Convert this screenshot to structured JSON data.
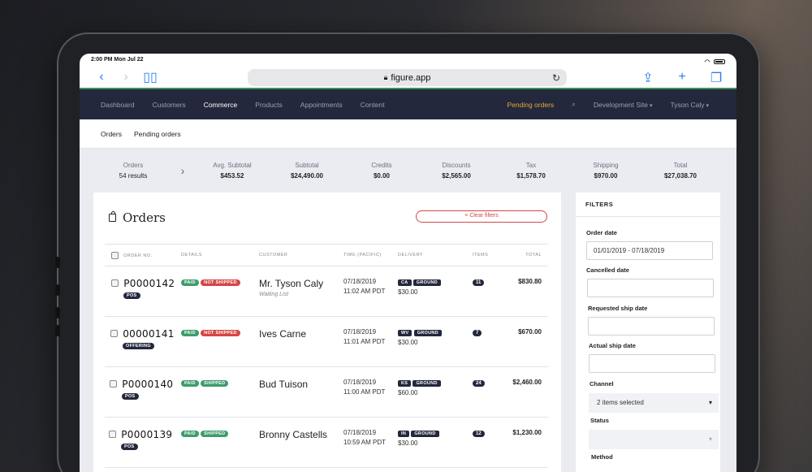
{
  "status_bar": {
    "time": "2:00 PM Mon Jul 22"
  },
  "browser": {
    "url": "figure.app",
    "lock_icon": "lock-icon"
  },
  "top_nav": {
    "items": [
      "Dashboard",
      "Customers",
      "Commerce",
      "Products",
      "Appointments",
      "Content"
    ],
    "active": "Commerce",
    "pending_orders": "Pending orders",
    "site": "Development Site",
    "user": "Tyson Caly"
  },
  "sub_nav": {
    "items": [
      "Orders",
      "Pending orders"
    ]
  },
  "summary": {
    "orders_label": "Orders",
    "orders_value": "54 results",
    "stats": [
      {
        "label": "Avg. Subtotal",
        "value": "$453.52"
      },
      {
        "label": "Subtotal",
        "value": "$24,490.00"
      },
      {
        "label": "Credits",
        "value": "$0.00"
      },
      {
        "label": "Discounts",
        "value": "$2,565.00"
      },
      {
        "label": "Tax",
        "value": "$1,578.70"
      },
      {
        "label": "Shipping",
        "value": "$970.00"
      },
      {
        "label": "Total",
        "value": "$27,038.70"
      }
    ]
  },
  "orders": {
    "title": "Orders",
    "clear_filters": "× Clear filters",
    "columns": [
      "ORDER NO.",
      "DETAILS",
      "CUSTOMER",
      "TIME (PACIFIC)",
      "DELIVERY",
      "ITEMS",
      "TOTAL"
    ],
    "rows": [
      {
        "order_no": "P0000142",
        "source": "POS",
        "paid": "PAID",
        "ship": "NOT SHIPPED",
        "customer": "Mr. Tyson Caly",
        "note": "Waiting List",
        "date": "07/18/2019",
        "time": "11:02 AM PDT",
        "state": "CA",
        "method": "GROUND",
        "delivery_cost": "$30.00",
        "items": "11",
        "total": "$830.80"
      },
      {
        "order_no": "00000141",
        "source": "OFFERING",
        "paid": "PAID",
        "ship": "NOT SHIPPED",
        "customer": "Ives Carne",
        "note": "",
        "date": "07/18/2019",
        "time": "11:01 AM PDT",
        "state": "WV",
        "method": "GROUND",
        "delivery_cost": "$30.00",
        "items": "7",
        "total": "$670.00"
      },
      {
        "order_no": "P0000140",
        "source": "POS",
        "paid": "PAID",
        "ship": "SHIPPED",
        "customer": "Bud Tuison",
        "note": "",
        "date": "07/18/2019",
        "time": "11:00 AM PDT",
        "state": "KS",
        "method": "GROUND",
        "delivery_cost": "$60.00",
        "items": "24",
        "total": "$2,460.00"
      },
      {
        "order_no": "P0000139",
        "source": "POS",
        "paid": "PAID",
        "ship": "SHIPPED",
        "customer": "Bronny Castells",
        "note": "",
        "date": "07/18/2019",
        "time": "10:59 AM PDT",
        "state": "IN",
        "method": "GROUND",
        "delivery_cost": "$30.00",
        "items": "12",
        "total": "$1,230.00"
      }
    ]
  },
  "filters": {
    "title": "FILTERS",
    "order_date_label": "Order date",
    "order_date_value": "01/01/2019 - 07/18/2019",
    "cancelled_label": "Cancelled date",
    "requested_label": "Requested ship date",
    "actual_label": "Actual ship date",
    "channel_label": "Channel",
    "channel_value": "2 items selected",
    "status_label": "Status",
    "method_label": "Method"
  },
  "colors": {
    "nav_bg": "#23283d",
    "accent_orange": "#e6a93a",
    "danger": "#d64545",
    "success": "#3d9c6b"
  }
}
